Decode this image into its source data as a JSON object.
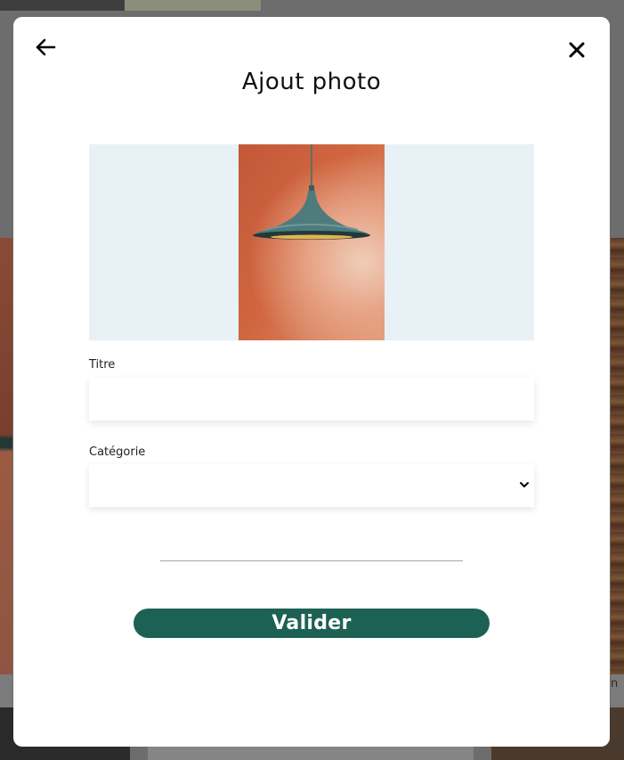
{
  "modal": {
    "title": "Ajout photo",
    "back_icon": "arrow-left-icon",
    "close_icon": "close-icon",
    "preview": {
      "description_icon": "pendant-lamp-photo",
      "background": "#e8f1f6"
    },
    "fields": {
      "title": {
        "label": "Titre",
        "value": ""
      },
      "category": {
        "label": "Catégorie",
        "selected": ""
      }
    },
    "submit_label": "Valider"
  },
  "background_page": {
    "caption_fragment": "n"
  },
  "colors": {
    "accent": "#1d6154",
    "overlay": "#6d6d6d",
    "preview_bg": "#e8f1f6"
  }
}
